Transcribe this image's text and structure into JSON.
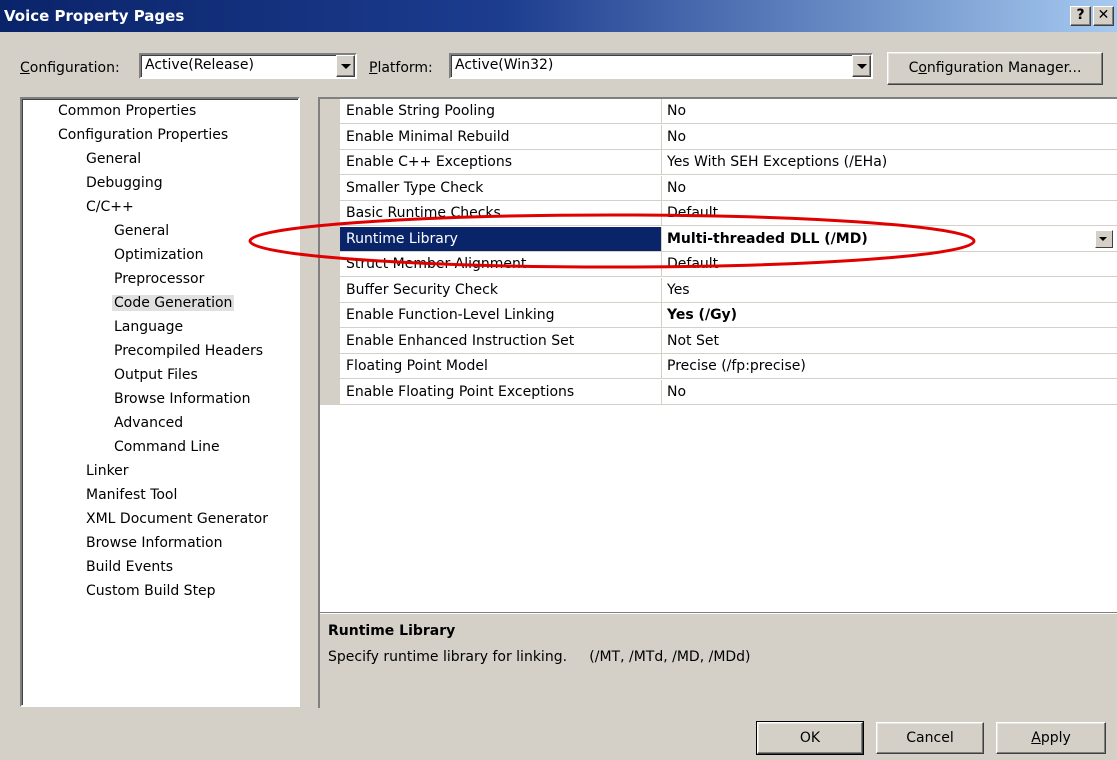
{
  "window": {
    "title": "Voice Property Pages",
    "help_glyph": "?",
    "close_glyph": "✕"
  },
  "toolbar": {
    "configuration_label_u": "C",
    "configuration_label_rest": "onfiguration:",
    "configuration_value": "Active(Release)",
    "platform_label_u": "P",
    "platform_label_rest": "latform:",
    "platform_value": "Active(Win32)",
    "config_manager_pre": "C",
    "config_manager_u": "o",
    "config_manager_rest": "nfiguration Manager..."
  },
  "tree": {
    "items": [
      {
        "label": "Common Properties"
      },
      {
        "label": "Configuration Properties"
      },
      {
        "label": "General"
      },
      {
        "label": "Debugging"
      },
      {
        "label": "C/C++"
      },
      {
        "label": "General"
      },
      {
        "label": "Optimization"
      },
      {
        "label": "Preprocessor"
      },
      {
        "label": "Code Generation"
      },
      {
        "label": "Language"
      },
      {
        "label": "Precompiled Headers"
      },
      {
        "label": "Output Files"
      },
      {
        "label": "Browse Information"
      },
      {
        "label": "Advanced"
      },
      {
        "label": "Command Line"
      },
      {
        "label": "Linker"
      },
      {
        "label": "Manifest Tool"
      },
      {
        "label": "XML Document Generator"
      },
      {
        "label": "Browse Information"
      },
      {
        "label": "Build Events"
      },
      {
        "label": "Custom Build Step"
      }
    ],
    "selected_index": 8
  },
  "properties": {
    "rows": [
      {
        "name": "Enable String Pooling",
        "value": "No"
      },
      {
        "name": "Enable Minimal Rebuild",
        "value": "No"
      },
      {
        "name": "Enable C++ Exceptions",
        "value": "Yes With SEH Exceptions (/EHa)"
      },
      {
        "name": "Smaller Type Check",
        "value": "No"
      },
      {
        "name": "Basic Runtime Checks",
        "value": "Default"
      },
      {
        "name": "Runtime Library",
        "value": "Multi-threaded DLL (/MD)"
      },
      {
        "name": "Struct Member Alignment",
        "value": "Default"
      },
      {
        "name": "Buffer Security Check",
        "value": "Yes"
      },
      {
        "name": "Enable Function-Level Linking",
        "value": "Yes (/Gy)"
      },
      {
        "name": "Enable Enhanced Instruction Set",
        "value": "Not Set"
      },
      {
        "name": "Floating Point Model",
        "value": "Precise (/fp:precise)"
      },
      {
        "name": "Enable Floating Point Exceptions",
        "value": "No"
      }
    ],
    "selected_index": 5,
    "bold_indices": [
      5,
      8
    ]
  },
  "description": {
    "title": "Runtime Library",
    "text": "Specify runtime library for linking.     (/MT, /MTd, /MD, /MDd)"
  },
  "buttons": {
    "ok": "OK",
    "cancel": "Cancel",
    "apply_u": "A",
    "apply_rest": "pply"
  },
  "colors": {
    "highlight_ellipse": "#e00000",
    "selection": "#0a246a",
    "dialog_face": "#d4d0c8"
  }
}
